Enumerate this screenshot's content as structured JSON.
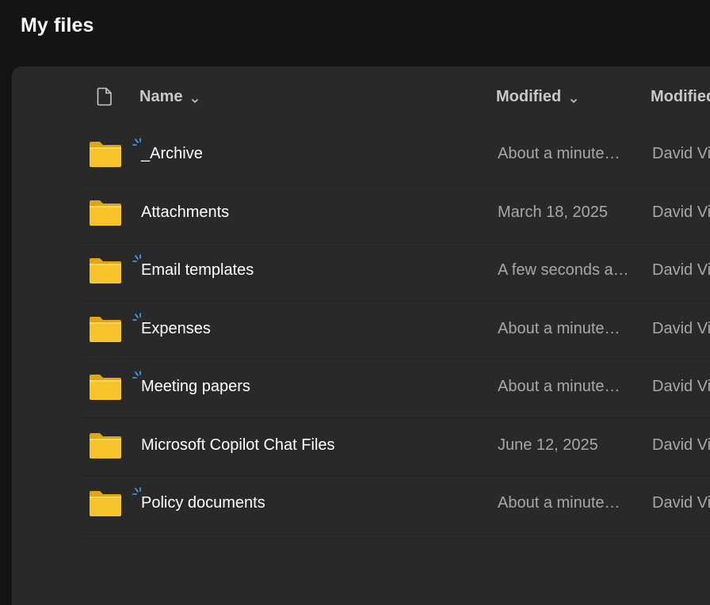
{
  "page": {
    "title": "My files"
  },
  "header": {
    "name_label": "Name",
    "modified_label": "Modified",
    "modified_by_label": "Modified By"
  },
  "colors": {
    "folder": "#f7c42b",
    "sync_accent": "#4ea5f5",
    "panel": "#292929",
    "background": "#141414"
  },
  "files": [
    {
      "name": "_Archive",
      "modified": "About a minute…",
      "modified_by": "David Vi",
      "new_badge": true
    },
    {
      "name": "Attachments",
      "modified": "March 18, 2025",
      "modified_by": "David Vi",
      "new_badge": false
    },
    {
      "name": "Email templates",
      "modified": "A few seconds a…",
      "modified_by": "David Vi",
      "new_badge": true
    },
    {
      "name": "Expenses",
      "modified": "About a minute…",
      "modified_by": "David Vi",
      "new_badge": true
    },
    {
      "name": "Meeting papers",
      "modified": "About a minute…",
      "modified_by": "David Vi",
      "new_badge": true
    },
    {
      "name": "Microsoft Copilot Chat Files",
      "modified": "June 12, 2025",
      "modified_by": "David Vi",
      "new_badge": false
    },
    {
      "name": "Policy documents",
      "modified": "About a minute…",
      "modified_by": "David Vi",
      "new_badge": true
    }
  ]
}
